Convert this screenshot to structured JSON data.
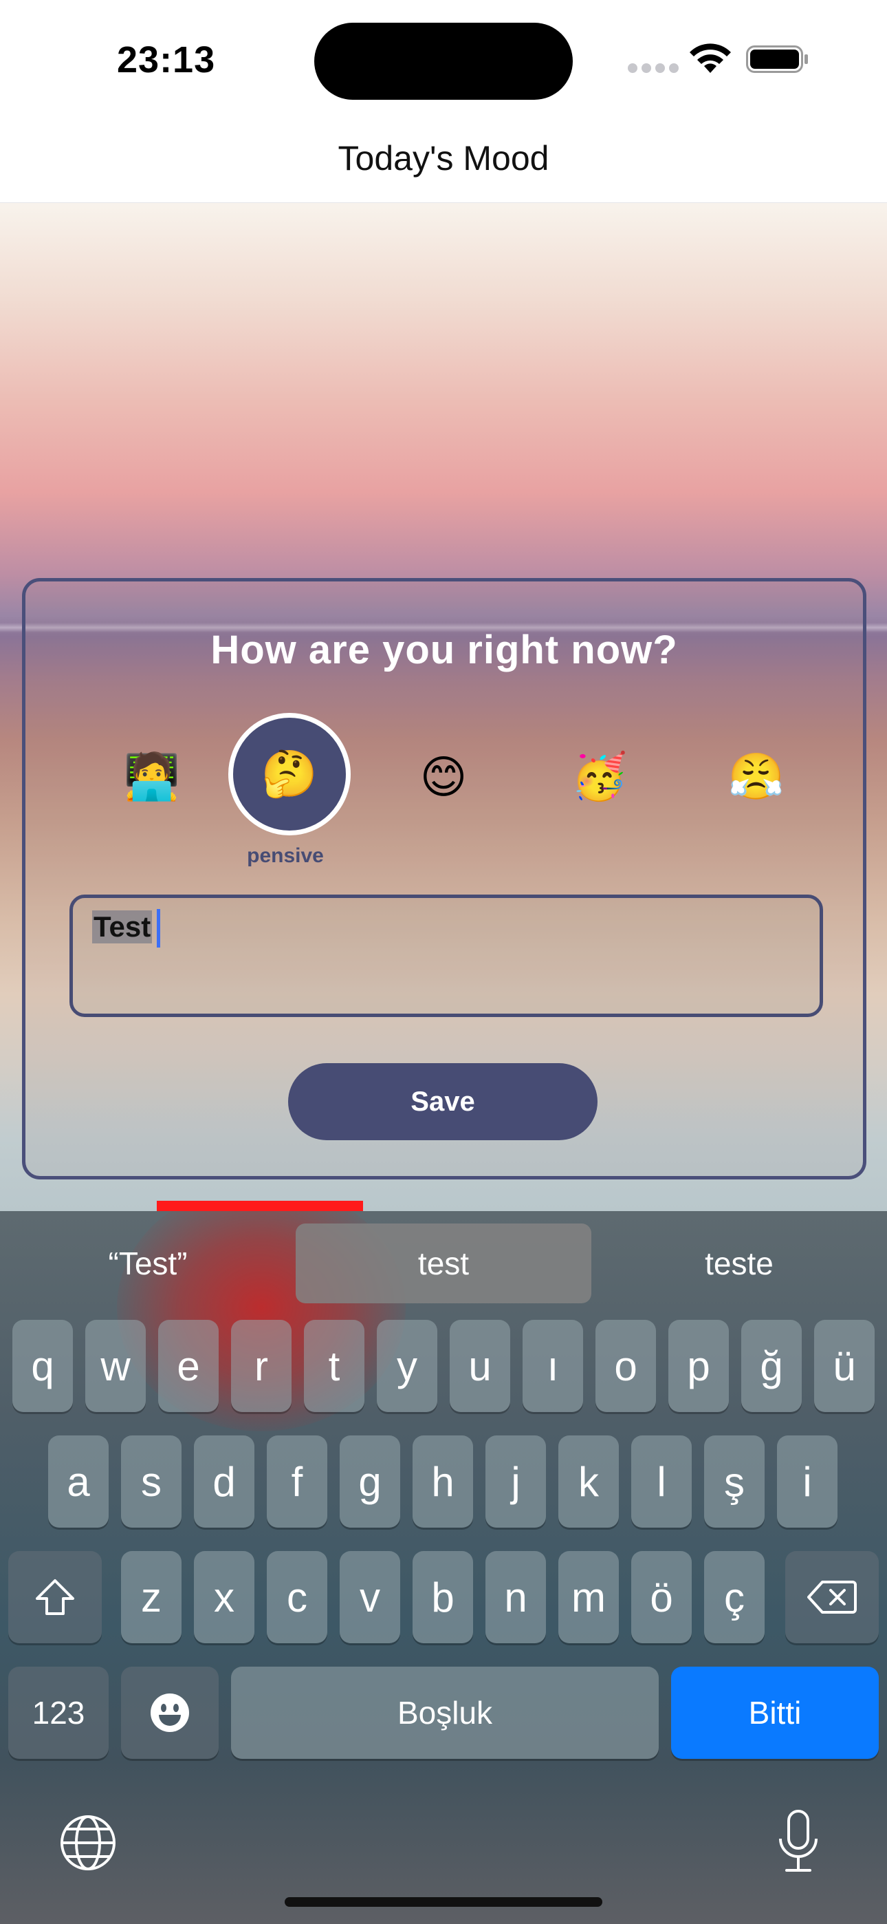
{
  "status_bar": {
    "time": "23:13",
    "icons": [
      "cellular-signal-icon",
      "wifi-icon",
      "battery-icon"
    ]
  },
  "nav": {
    "title": "Today's Mood"
  },
  "card": {
    "title": "How are you right now?",
    "moods": [
      {
        "emoji": "🧑‍💻",
        "name": "technologist",
        "selected": false
      },
      {
        "emoji": "🤔",
        "name": "pensive",
        "selected": true
      },
      {
        "emoji": "😊",
        "name": "smiling",
        "selected": false
      },
      {
        "emoji": "🥳",
        "name": "partying",
        "selected": false
      },
      {
        "emoji": "😤",
        "name": "huffing",
        "selected": false
      }
    ],
    "selected_label": "pensive",
    "note_value": "Test",
    "save_label": "Save"
  },
  "keyboard": {
    "suggestions": [
      "“Test”",
      "test",
      "teste"
    ],
    "active_suggestion": "test",
    "row1": [
      "q",
      "w",
      "e",
      "r",
      "t",
      "y",
      "u",
      "ı",
      "o",
      "p",
      "ğ",
      "ü"
    ],
    "row2": [
      "a",
      "s",
      "d",
      "f",
      "g",
      "h",
      "j",
      "k",
      "l",
      "ş",
      "i"
    ],
    "row3": [
      "z",
      "x",
      "c",
      "v",
      "b",
      "n",
      "m",
      "ö",
      "ç"
    ],
    "numbers_label": "123",
    "space_label": "Boşluk",
    "done_label": "Bitti",
    "accent_color": "#0a7aff",
    "icons": [
      "shift-icon",
      "backspace-icon",
      "emoji-icon",
      "globe-icon",
      "microphone-icon"
    ]
  },
  "colors": {
    "primary": "#474c74",
    "card_title": "#ffffff"
  }
}
